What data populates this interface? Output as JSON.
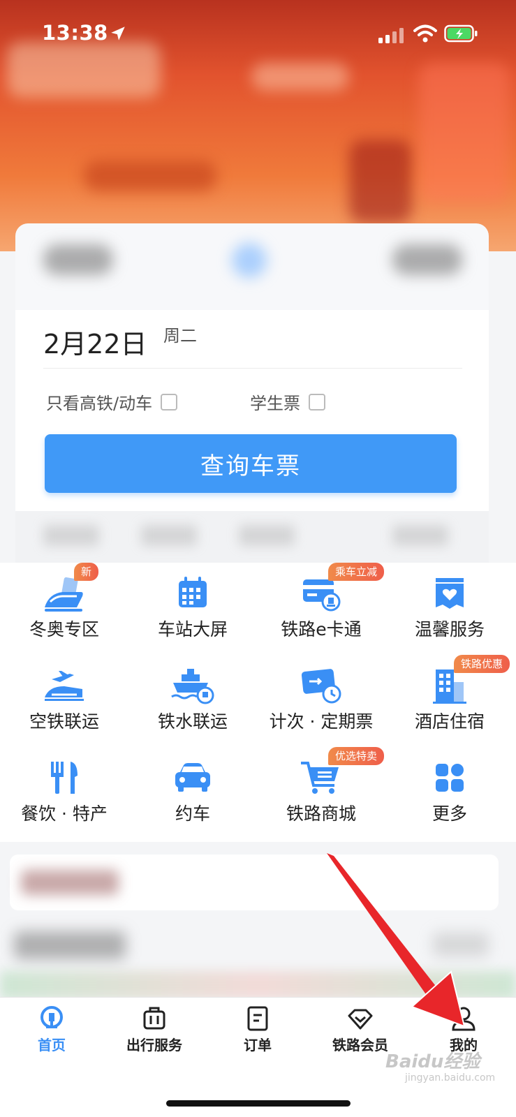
{
  "status_bar": {
    "time": "13:38"
  },
  "search": {
    "date": "2月22日",
    "weekday": "周二",
    "option_highspeed": "只看高铁/动车",
    "option_student": "学生票",
    "query_button": "查询车票"
  },
  "services": [
    {
      "label": "冬奥专区",
      "badge": "新",
      "icon": "winter-olympics-icon"
    },
    {
      "label": "车站大屏",
      "badge": "",
      "icon": "station-screen-icon"
    },
    {
      "label": "铁路e卡通",
      "badge": "乘车立减",
      "icon": "railway-ecard-icon"
    },
    {
      "label": "温馨服务",
      "badge": "",
      "icon": "warm-service-icon"
    },
    {
      "label": "空铁联运",
      "badge": "",
      "icon": "air-rail-icon"
    },
    {
      "label": "铁水联运",
      "badge": "",
      "icon": "rail-water-icon"
    },
    {
      "label": "计次 · 定期票",
      "badge": "",
      "icon": "period-ticket-icon"
    },
    {
      "label": "酒店住宿",
      "badge": "铁路优惠",
      "icon": "hotel-icon"
    },
    {
      "label": "餐饮 · 特产",
      "badge": "",
      "icon": "dining-icon"
    },
    {
      "label": "约车",
      "badge": "",
      "icon": "car-icon"
    },
    {
      "label": "铁路商城",
      "badge": "优选特卖",
      "icon": "shopping-cart-icon"
    },
    {
      "label": "更多",
      "badge": "",
      "icon": "more-grid-icon"
    }
  ],
  "tabs": [
    {
      "label": "首页",
      "icon": "home-logo-icon",
      "active": true
    },
    {
      "label": "出行服务",
      "icon": "luggage-icon",
      "active": false
    },
    {
      "label": "订单",
      "icon": "order-icon",
      "active": false
    },
    {
      "label": "铁路会员",
      "icon": "member-diamond-icon",
      "active": false
    },
    {
      "label": "我的",
      "icon": "profile-icon",
      "active": false
    }
  ],
  "watermark": {
    "text": "Baidu经验",
    "sub": "jingyan.baidu.com"
  },
  "colors": {
    "primary": "#4099f7",
    "badge": "#ef6a4a",
    "icon_blue": "#3a8ff5",
    "annotation": "#e8262a"
  }
}
